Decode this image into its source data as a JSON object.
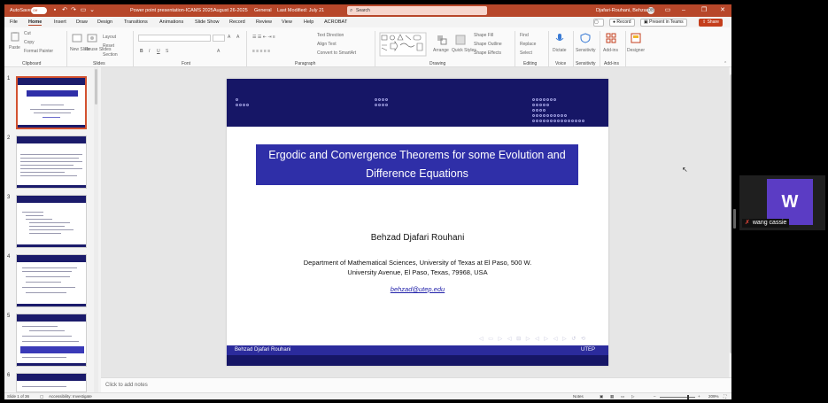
{
  "title_bar": {
    "autosave_label": "AutoSave",
    "autosave_state": "Off",
    "doc_title": "Power point presentation-ICAMS 2025August 26-2025",
    "sensitivity": "General",
    "last_modified": "Last Modified: July 21",
    "search_placeholder": "Search",
    "user_name": "Djafari-Rouhani, Behzad",
    "user_initials": "DB"
  },
  "menu_tabs": [
    "File",
    "Home",
    "Insert",
    "Draw",
    "Design",
    "Transitions",
    "Animations",
    "Slide Show",
    "Record",
    "Review",
    "View",
    "Help",
    "ACROBAT"
  ],
  "active_tab": "Home",
  "menu_right": {
    "record": "Record",
    "present": "Present in Teams",
    "share": "Share"
  },
  "ribbon": {
    "clipboard": {
      "paste": "Paste",
      "cut": "Cut",
      "copy": "Copy",
      "format_painter": "Format Painter",
      "label": "Clipboard"
    },
    "slides": {
      "new_slide": "New Slide",
      "reuse_slides": "Reuse Slides",
      "layout": "Layout",
      "reset": "Reset",
      "section": "Section",
      "label": "Slides"
    },
    "font": {
      "label": "Font"
    },
    "paragraph": {
      "text_direction": "Text Direction",
      "align_text": "Align Text",
      "smartart": "Convert to SmartArt",
      "label": "Paragraph"
    },
    "drawing": {
      "arrange": "Arrange",
      "quick_styles": "Quick Styles",
      "shape_fill": "Shape Fill",
      "shape_outline": "Shape Outline",
      "shape_effects": "Shape Effects",
      "label": "Drawing"
    },
    "editing": {
      "find": "Find",
      "replace": "Replace",
      "select": "Select",
      "label": "Editing"
    },
    "voice": {
      "dictate": "Dictate",
      "label": "Voice"
    },
    "sensitivity": {
      "button": "Sensitivity",
      "label": "Sensitivity"
    },
    "addins": {
      "button": "Add-ins",
      "label": "Add-ins"
    },
    "designer": {
      "button": "Designer"
    }
  },
  "thumbnails": [
    "1",
    "2",
    "3",
    "4",
    "5",
    "6"
  ],
  "slide": {
    "title": "Ergodic and Convergence Theorems for some Evolution and Difference Equations",
    "author": "Behzad Djafari Rouhani",
    "affiliation_line1": "Department of Mathematical Sciences, University of Texas at El Paso, 500 W.",
    "affiliation_line2": "University Avenue, El Paso, Texas, 79968, USA",
    "email": "behzad@utep.edu",
    "footer_left": "Behzad Djafari Rouhani",
    "footer_right": "UTEP"
  },
  "notes_placeholder": "Click to add notes",
  "status_bar": {
    "slide_info": "Slide 1 of 36",
    "accessibility": "Accessibility: Investigate",
    "notes": "Notes",
    "zoom": "209%"
  },
  "video_call": {
    "avatar_initial": "W",
    "participant_name": "wang cassie"
  },
  "colors": {
    "ppt_accent": "#b7472a",
    "slide_header": "#161666",
    "title_box": "#2f2fa8",
    "avatar": "#5b3cc4"
  }
}
